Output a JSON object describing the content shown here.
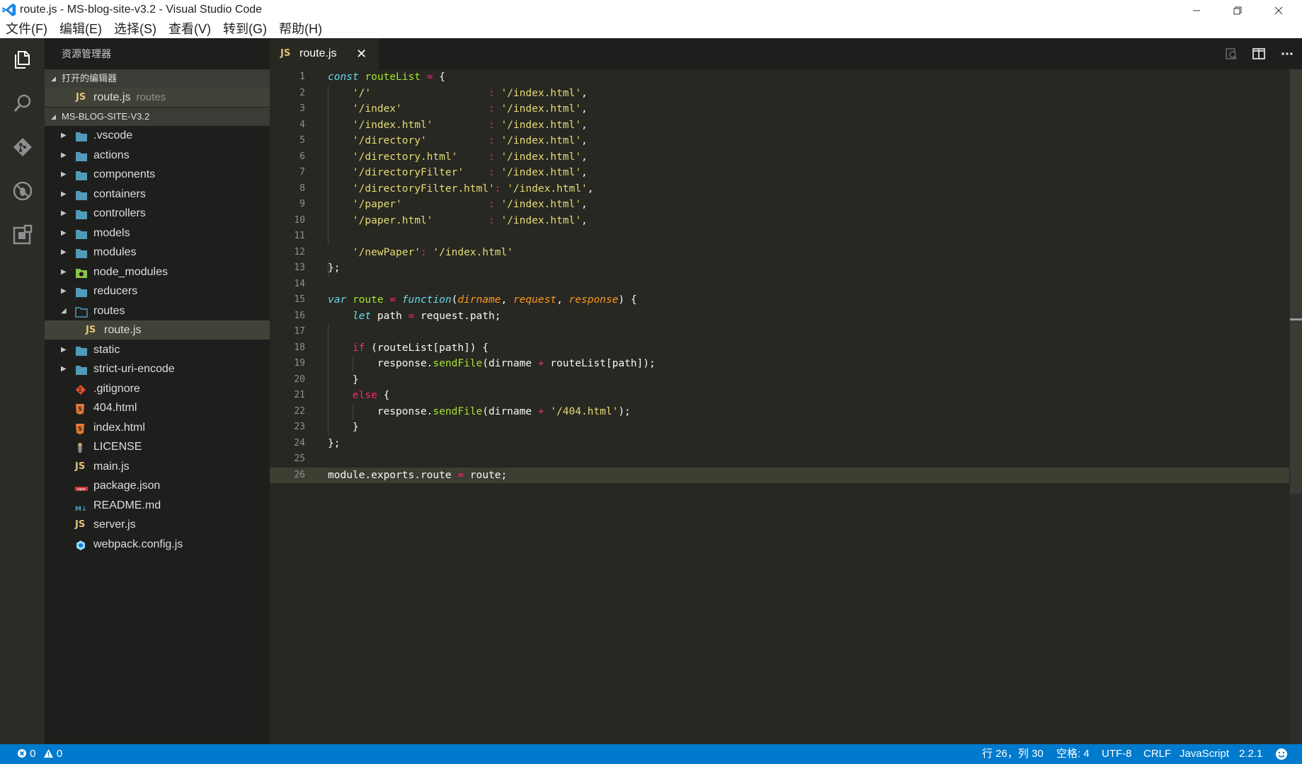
{
  "window": {
    "title": "route.js - MS-blog-site-v3.2 - Visual Studio Code",
    "minimize": "—",
    "restore": "❐",
    "close": "✕"
  },
  "menu": [
    "文件(F)",
    "编辑(E)",
    "选择(S)",
    "查看(V)",
    "转到(G)",
    "帮助(H)"
  ],
  "activity": [
    "explorer-icon",
    "search-icon",
    "git-icon",
    "debug-icon",
    "extensions-icon"
  ],
  "sidebar": {
    "title": "资源管理器",
    "open_editors": {
      "label": "打开的编辑器",
      "items": [
        {
          "icon": "JS",
          "name": "route.js",
          "desc": "routes"
        }
      ]
    },
    "project": {
      "label": "MS-BLOG-SITE-V3.2",
      "items": [
        {
          "name": ".vscode",
          "icon": "folder-icon"
        },
        {
          "name": "actions",
          "icon": "folder-icon"
        },
        {
          "name": "components",
          "icon": "folder-icon"
        },
        {
          "name": "containers",
          "icon": "folder-icon"
        },
        {
          "name": "controllers",
          "icon": "folder-icon"
        },
        {
          "name": "models",
          "icon": "folder-icon"
        },
        {
          "name": "modules",
          "icon": "folder-icon"
        },
        {
          "name": "node_modules",
          "icon": "node-folder-icon"
        },
        {
          "name": "reducers",
          "icon": "folder-icon"
        },
        {
          "name": "routes",
          "icon": "folder-open-icon"
        },
        {
          "name": "route.js",
          "icon": "js-file-icon"
        },
        {
          "name": "static",
          "icon": "folder-icon"
        },
        {
          "name": "strict-uri-encode",
          "icon": "folder-icon"
        },
        {
          "name": ".gitignore",
          "icon": "git-file-icon"
        },
        {
          "name": "404.html",
          "icon": "html-file-icon"
        },
        {
          "name": "index.html",
          "icon": "html-file-icon"
        },
        {
          "name": "LICENSE",
          "icon": "license-file-icon"
        },
        {
          "name": "main.js",
          "icon": "js-file-icon"
        },
        {
          "name": "package.json",
          "icon": "npm-file-icon"
        },
        {
          "name": "README.md",
          "icon": "markdown-file-icon"
        },
        {
          "name": "server.js",
          "icon": "js-file-icon"
        },
        {
          "name": "webpack.config.js",
          "icon": "webpack-file-icon"
        }
      ]
    }
  },
  "editor": {
    "tab": {
      "icon": "JS",
      "label": "route.js",
      "close": "✕"
    },
    "lines": [
      [
        [
          "kw",
          "const"
        ],
        [
          "pl",
          " "
        ],
        [
          "def",
          "routeList"
        ],
        [
          "pl",
          " "
        ],
        [
          "op",
          "="
        ],
        [
          "pl",
          " {"
        ]
      ],
      [
        [
          "pl",
          "    "
        ],
        [
          "str",
          "'/'"
        ],
        [
          "pl",
          "                   "
        ],
        [
          "op",
          ":"
        ],
        [
          "pl",
          " "
        ],
        [
          "str",
          "'/index.html'"
        ],
        [
          "pl",
          ","
        ]
      ],
      [
        [
          "pl",
          "    "
        ],
        [
          "str",
          "'/index'"
        ],
        [
          "pl",
          "              "
        ],
        [
          "op",
          ":"
        ],
        [
          "pl",
          " "
        ],
        [
          "str",
          "'/index.html'"
        ],
        [
          "pl",
          ","
        ]
      ],
      [
        [
          "pl",
          "    "
        ],
        [
          "str",
          "'/index.html'"
        ],
        [
          "pl",
          "         "
        ],
        [
          "op",
          ":"
        ],
        [
          "pl",
          " "
        ],
        [
          "str",
          "'/index.html'"
        ],
        [
          "pl",
          ","
        ]
      ],
      [
        [
          "pl",
          "    "
        ],
        [
          "str",
          "'/directory'"
        ],
        [
          "pl",
          "          "
        ],
        [
          "op",
          ":"
        ],
        [
          "pl",
          " "
        ],
        [
          "str",
          "'/index.html'"
        ],
        [
          "pl",
          ","
        ]
      ],
      [
        [
          "pl",
          "    "
        ],
        [
          "str",
          "'/directory.html'"
        ],
        [
          "pl",
          "     "
        ],
        [
          "op",
          ":"
        ],
        [
          "pl",
          " "
        ],
        [
          "str",
          "'/index.html'"
        ],
        [
          "pl",
          ","
        ]
      ],
      [
        [
          "pl",
          "    "
        ],
        [
          "str",
          "'/directoryFilter'"
        ],
        [
          "pl",
          "    "
        ],
        [
          "op",
          ":"
        ],
        [
          "pl",
          " "
        ],
        [
          "str",
          "'/index.html'"
        ],
        [
          "pl",
          ","
        ]
      ],
      [
        [
          "pl",
          "    "
        ],
        [
          "str",
          "'/directoryFilter.html'"
        ],
        [
          "op",
          ":"
        ],
        [
          "pl",
          " "
        ],
        [
          "str",
          "'/index.html'"
        ],
        [
          "pl",
          ","
        ]
      ],
      [
        [
          "pl",
          "    "
        ],
        [
          "str",
          "'/paper'"
        ],
        [
          "pl",
          "              "
        ],
        [
          "op",
          ":"
        ],
        [
          "pl",
          " "
        ],
        [
          "str",
          "'/index.html'"
        ],
        [
          "pl",
          ","
        ]
      ],
      [
        [
          "pl",
          "    "
        ],
        [
          "str",
          "'/paper.html'"
        ],
        [
          "pl",
          "         "
        ],
        [
          "op",
          ":"
        ],
        [
          "pl",
          " "
        ],
        [
          "str",
          "'/index.html'"
        ],
        [
          "pl",
          ","
        ]
      ],
      [],
      [
        [
          "pl",
          "    "
        ],
        [
          "str",
          "'/newPaper'"
        ],
        [
          "op",
          ":"
        ],
        [
          "pl",
          " "
        ],
        [
          "str",
          "'/index.html'"
        ]
      ],
      [
        [
          "pl",
          "};"
        ]
      ],
      [],
      [
        [
          "kw",
          "var"
        ],
        [
          "pl",
          " "
        ],
        [
          "def",
          "route"
        ],
        [
          "pl",
          " "
        ],
        [
          "op",
          "="
        ],
        [
          "pl",
          " "
        ],
        [
          "kw",
          "function"
        ],
        [
          "pl",
          "("
        ],
        [
          "param",
          "dirname"
        ],
        [
          "pl",
          ", "
        ],
        [
          "param",
          "request"
        ],
        [
          "pl",
          ", "
        ],
        [
          "param",
          "response"
        ],
        [
          "pl",
          ") {"
        ]
      ],
      [
        [
          "pl",
          "    "
        ],
        [
          "kw",
          "let"
        ],
        [
          "pl",
          " path "
        ],
        [
          "op",
          "="
        ],
        [
          "pl",
          " request.path;"
        ]
      ],
      [],
      [
        [
          "pl",
          "    "
        ],
        [
          "op",
          "if"
        ],
        [
          "pl",
          " (routeList[path]) {"
        ]
      ],
      [
        [
          "pl",
          "        response."
        ],
        [
          "fn",
          "sendFile"
        ],
        [
          "pl",
          "(dirname "
        ],
        [
          "op",
          "+"
        ],
        [
          "pl",
          " routeList[path]);"
        ]
      ],
      [
        [
          "pl",
          "    }"
        ]
      ],
      [
        [
          "pl",
          "    "
        ],
        [
          "op",
          "else"
        ],
        [
          "pl",
          " {"
        ]
      ],
      [
        [
          "pl",
          "        response."
        ],
        [
          "fn",
          "sendFile"
        ],
        [
          "pl",
          "(dirname "
        ],
        [
          "op",
          "+"
        ],
        [
          "pl",
          " "
        ],
        [
          "str",
          "'/404.html'"
        ],
        [
          "pl",
          ");"
        ]
      ],
      [
        [
          "pl",
          "    }"
        ]
      ],
      [
        [
          "pl",
          "};"
        ]
      ],
      [],
      [
        [
          "pl",
          "module.exports.route "
        ],
        [
          "op",
          "="
        ],
        [
          "pl",
          " route;"
        ]
      ]
    ],
    "current_line": 26
  },
  "statusbar": {
    "errors": "0",
    "warnings": "0",
    "position": "行 26，列 30",
    "indent": "空格: 4",
    "encoding": "UTF-8",
    "eol": "CRLF",
    "language": "JavaScript",
    "version": "2.2.1"
  },
  "colors": {
    "accent": "#007acc",
    "editor_bg": "#272822",
    "sidebar_bg": "#1e1f1c",
    "folder": "#519aba"
  }
}
